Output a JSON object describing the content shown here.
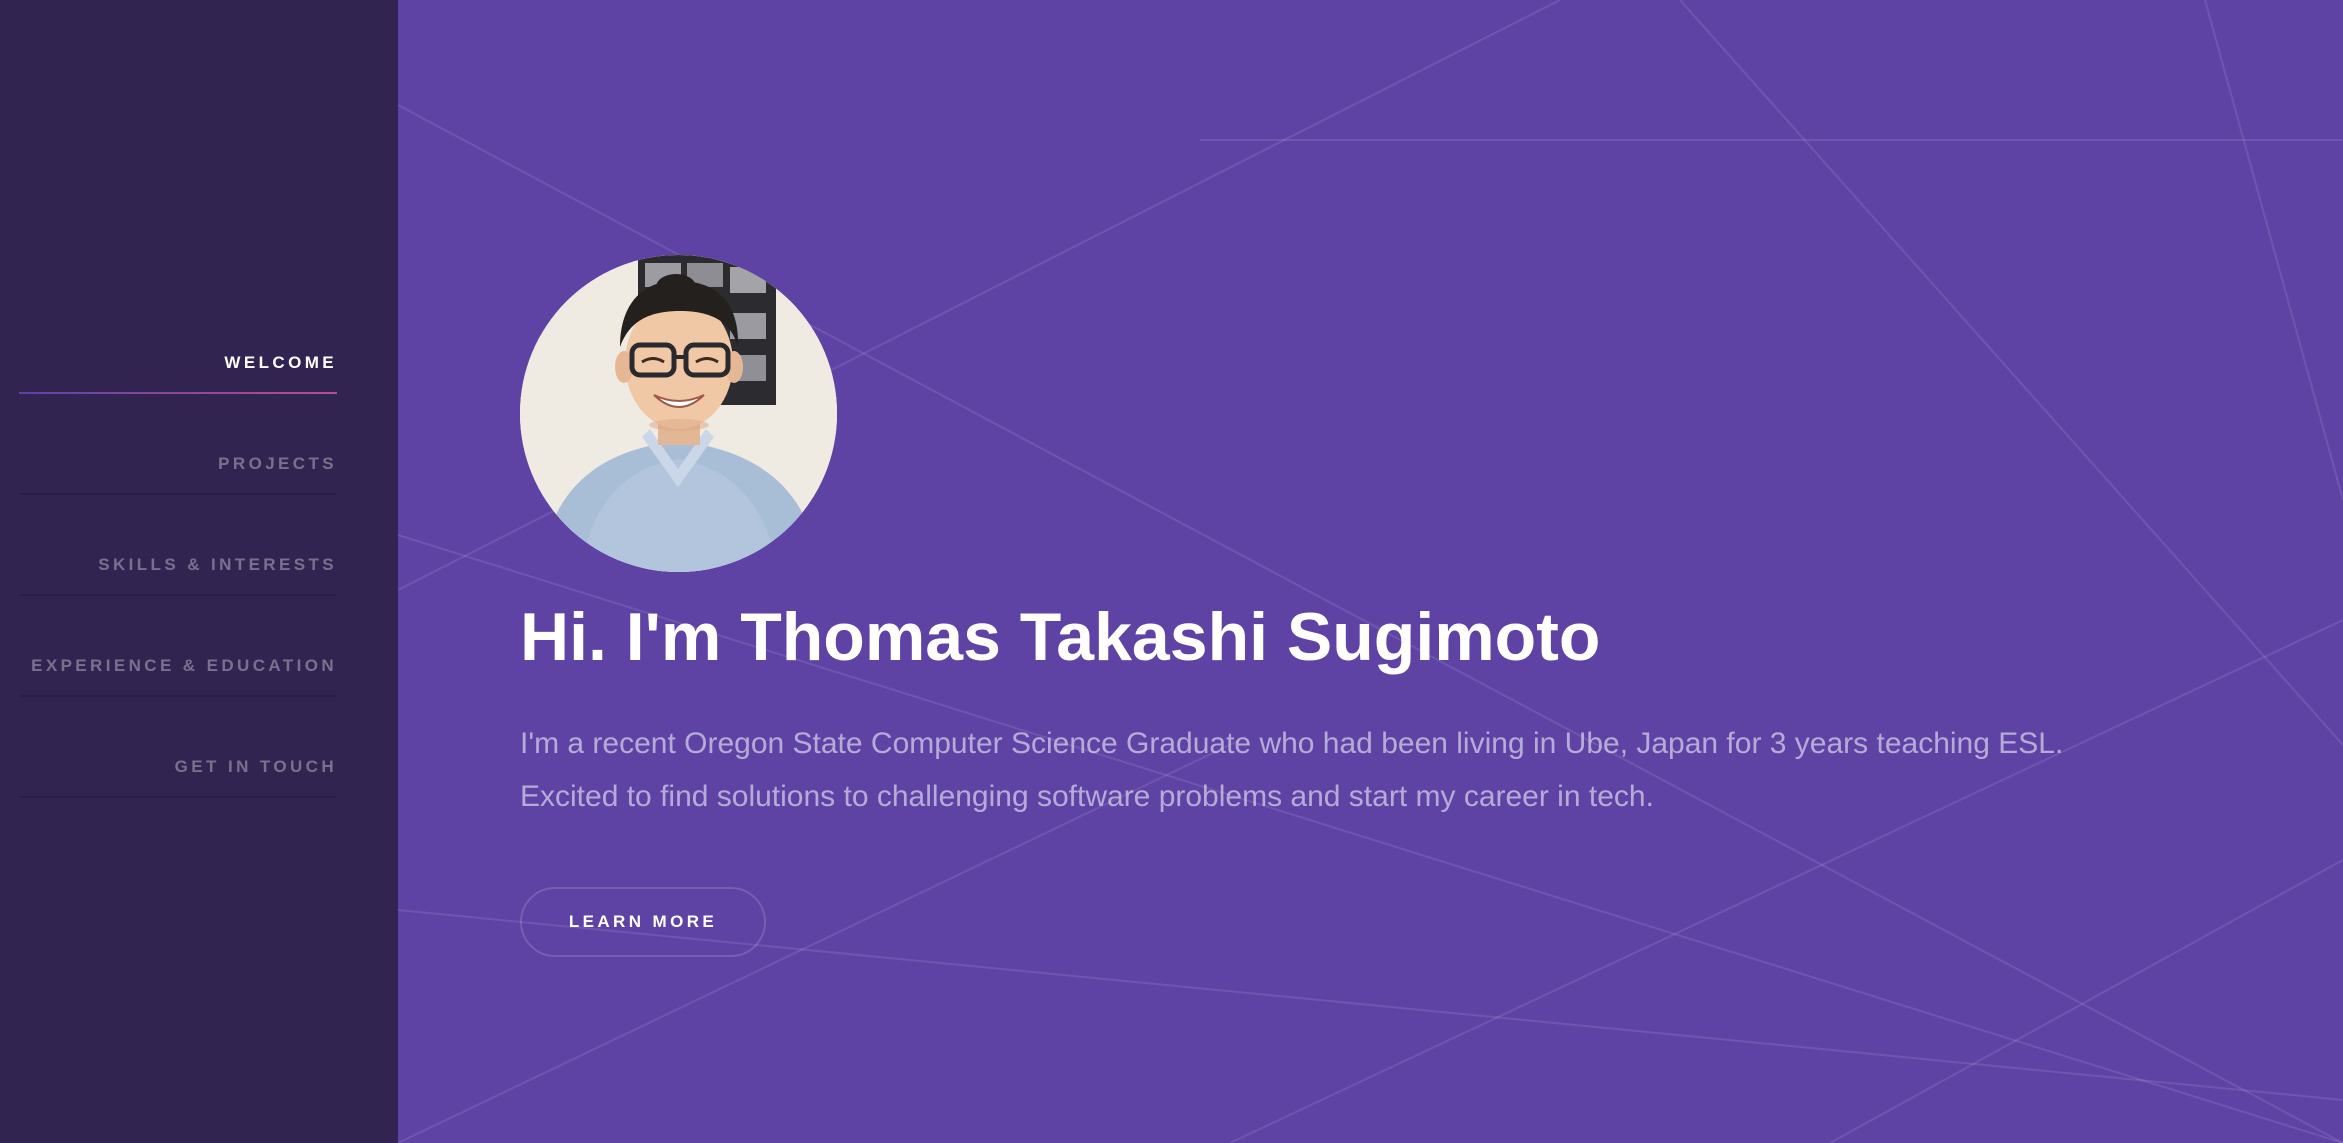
{
  "sidebar": {
    "items": [
      {
        "label": "Welcome",
        "active": true
      },
      {
        "label": "Projects",
        "active": false
      },
      {
        "label": "Skills & Interests",
        "active": false
      },
      {
        "label": "Experience & Education",
        "active": false
      },
      {
        "label": "Get in Touch",
        "active": false
      }
    ]
  },
  "hero": {
    "headline": "Hi. I'm Thomas Takashi Sugimoto",
    "intro_line1": "I'm a recent Oregon State Computer Science Graduate who had been living in Ube, Japan for 3 years teaching ESL.",
    "intro_line2": "Excited to find solutions to challenging software problems and start my career in tech.",
    "button_label": "Learn More"
  },
  "colors": {
    "sidebar_bg": "#312450",
    "main_bg": "#5e43a5",
    "accent_start": "#5e42a6",
    "accent_end": "#b74e91"
  }
}
